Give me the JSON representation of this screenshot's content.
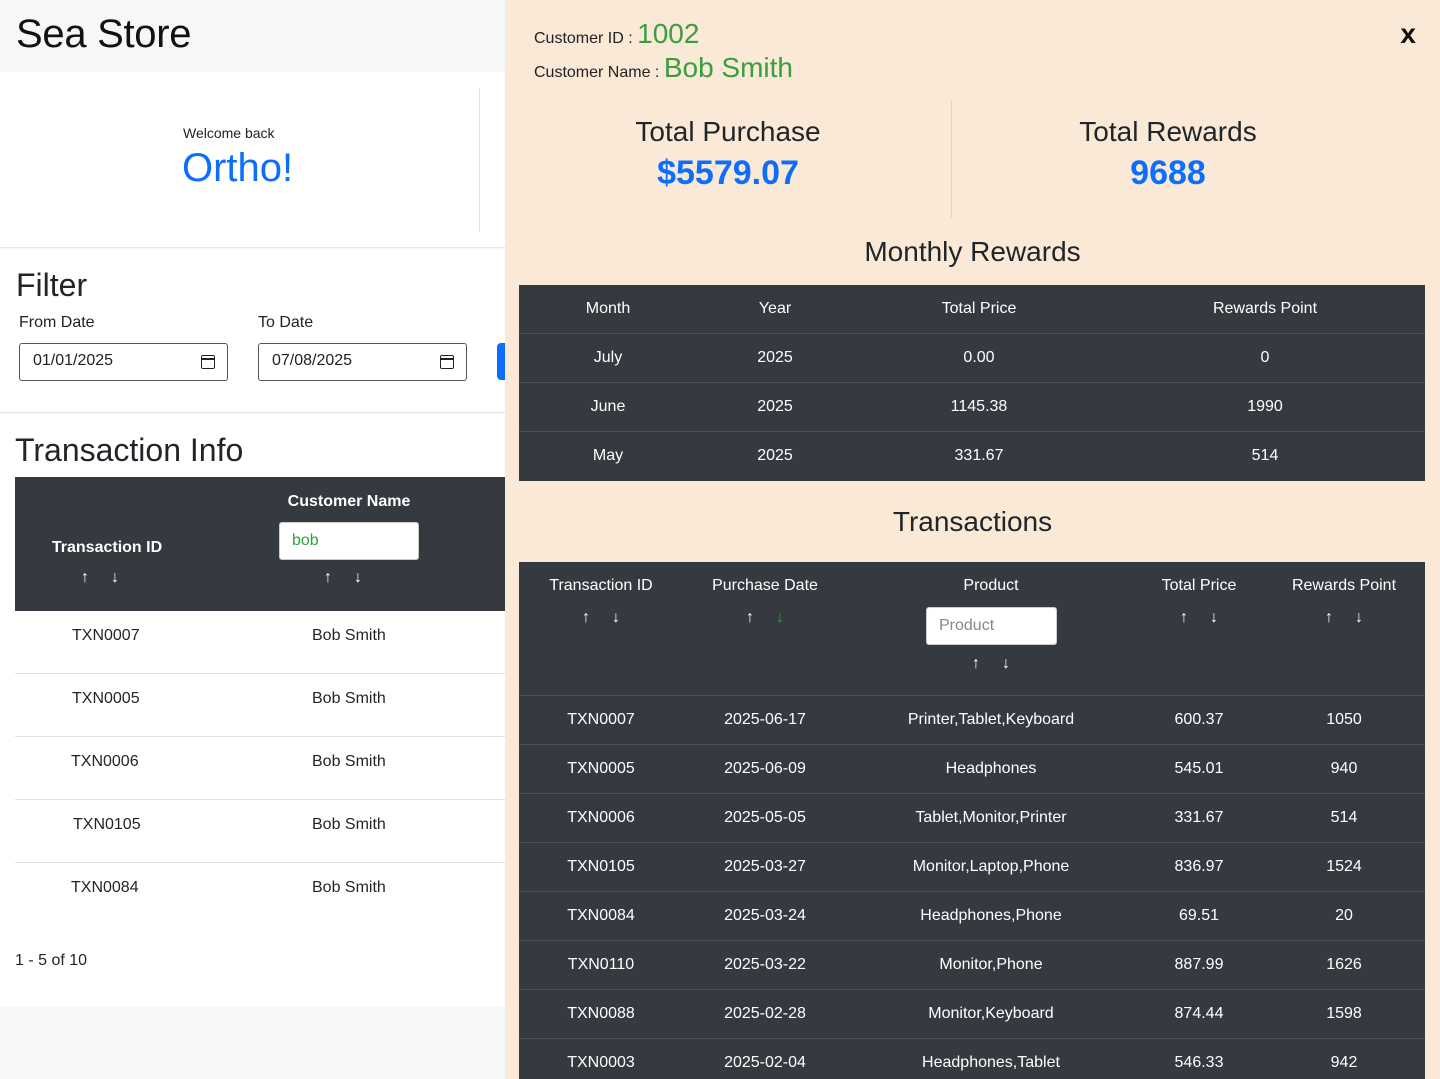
{
  "store": {
    "title": "Sea Store"
  },
  "welcome": {
    "greeting": "Welcome back",
    "name": "Ortho!"
  },
  "filter": {
    "title": "Filter",
    "from_label": "From Date",
    "from_value": "01/01/2025",
    "to_label": "To Date",
    "to_value": "07/08/2025"
  },
  "transaction_info": {
    "title": "Transaction Info",
    "columns": [
      "Transaction ID",
      "Customer Name"
    ],
    "customer_filter_value": "bob",
    "rows": [
      {
        "id": "TXN0007",
        "name": "Bob Smith"
      },
      {
        "id": "TXN0005",
        "name": "Bob Smith"
      },
      {
        "id": "TXN0006",
        "name": "Bob Smith"
      },
      {
        "id": "TXN0105",
        "name": "Bob Smith"
      },
      {
        "id": "TXN0084",
        "name": "Bob Smith"
      }
    ],
    "pagination": "1 - 5 of 10"
  },
  "drawer": {
    "close_label": "x",
    "customer_id_label": "Customer ID :",
    "customer_id": "1002",
    "customer_name_label": "Customer Name :",
    "customer_name": "Bob Smith",
    "total_purchase_label": "Total Purchase",
    "total_purchase": "$5579.07",
    "total_rewards_label": "Total Rewards",
    "total_rewards": "9688",
    "monthly": {
      "title": "Monthly Rewards",
      "columns": [
        "Month",
        "Year",
        "Total Price",
        "Rewards Point"
      ],
      "rows": [
        [
          "July",
          "2025",
          "0.00",
          "0"
        ],
        [
          "June",
          "2025",
          "1145.38",
          "1990"
        ],
        [
          "May",
          "2025",
          "331.67",
          "514"
        ]
      ]
    },
    "transactions": {
      "title": "Transactions",
      "columns": [
        "Transaction ID",
        "Purchase Date",
        "Product",
        "Total Price",
        "Rewards Point"
      ],
      "product_placeholder": "Product",
      "rows": [
        [
          "TXN0007",
          "2025-06-17",
          "Printer,Tablet,Keyboard",
          "600.37",
          "1050"
        ],
        [
          "TXN0005",
          "2025-06-09",
          "Headphones",
          "545.01",
          "940"
        ],
        [
          "TXN0006",
          "2025-05-05",
          "Tablet,Monitor,Printer",
          "331.67",
          "514"
        ],
        [
          "TXN0105",
          "2025-03-27",
          "Monitor,Laptop,Phone",
          "836.97",
          "1524"
        ],
        [
          "TXN0084",
          "2025-03-24",
          "Headphones,Phone",
          "69.51",
          "20"
        ],
        [
          "TXN0110",
          "2025-03-22",
          "Monitor,Phone",
          "887.99",
          "1626"
        ],
        [
          "TXN0088",
          "2025-02-28",
          "Monitor,Keyboard",
          "874.44",
          "1598"
        ],
        [
          "TXN0003",
          "2025-02-04",
          "Headphones,Tablet",
          "546.33",
          "942"
        ]
      ]
    }
  },
  "icons": {
    "sort_up": "↑",
    "sort_down": "↓",
    "calendar": "calendar-icon"
  },
  "colors": {
    "accent_blue": "#0d6efd",
    "accent_green": "#3a9e3f",
    "drawer_bg": "#f9e9d6",
    "table_dark": "#343a40"
  }
}
